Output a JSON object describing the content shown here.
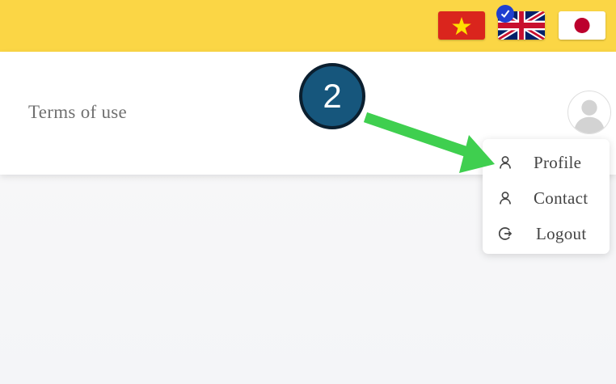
{
  "header": {
    "background_color": "#fbd645",
    "languages": [
      {
        "code": "vi",
        "flag_icon": "vietnam-flag-icon",
        "selected": false
      },
      {
        "code": "en",
        "flag_icon": "uk-flag-icon",
        "selected": true
      },
      {
        "code": "ja",
        "flag_icon": "japan-flag-icon",
        "selected": false
      }
    ],
    "selected_icon": "checkmark-icon"
  },
  "navbar": {
    "terms_label": "Terms of use",
    "avatar_icon": "user-avatar-icon"
  },
  "user_menu": {
    "items": [
      {
        "label": "Profile",
        "icon": "person-icon"
      },
      {
        "label": "Contact",
        "icon": "person-icon"
      },
      {
        "label": "Logout",
        "icon": "logout-icon"
      }
    ]
  },
  "annotation": {
    "step_number": "2",
    "marker_color": "#16567c",
    "arrow_color": "#3fcf4f"
  }
}
